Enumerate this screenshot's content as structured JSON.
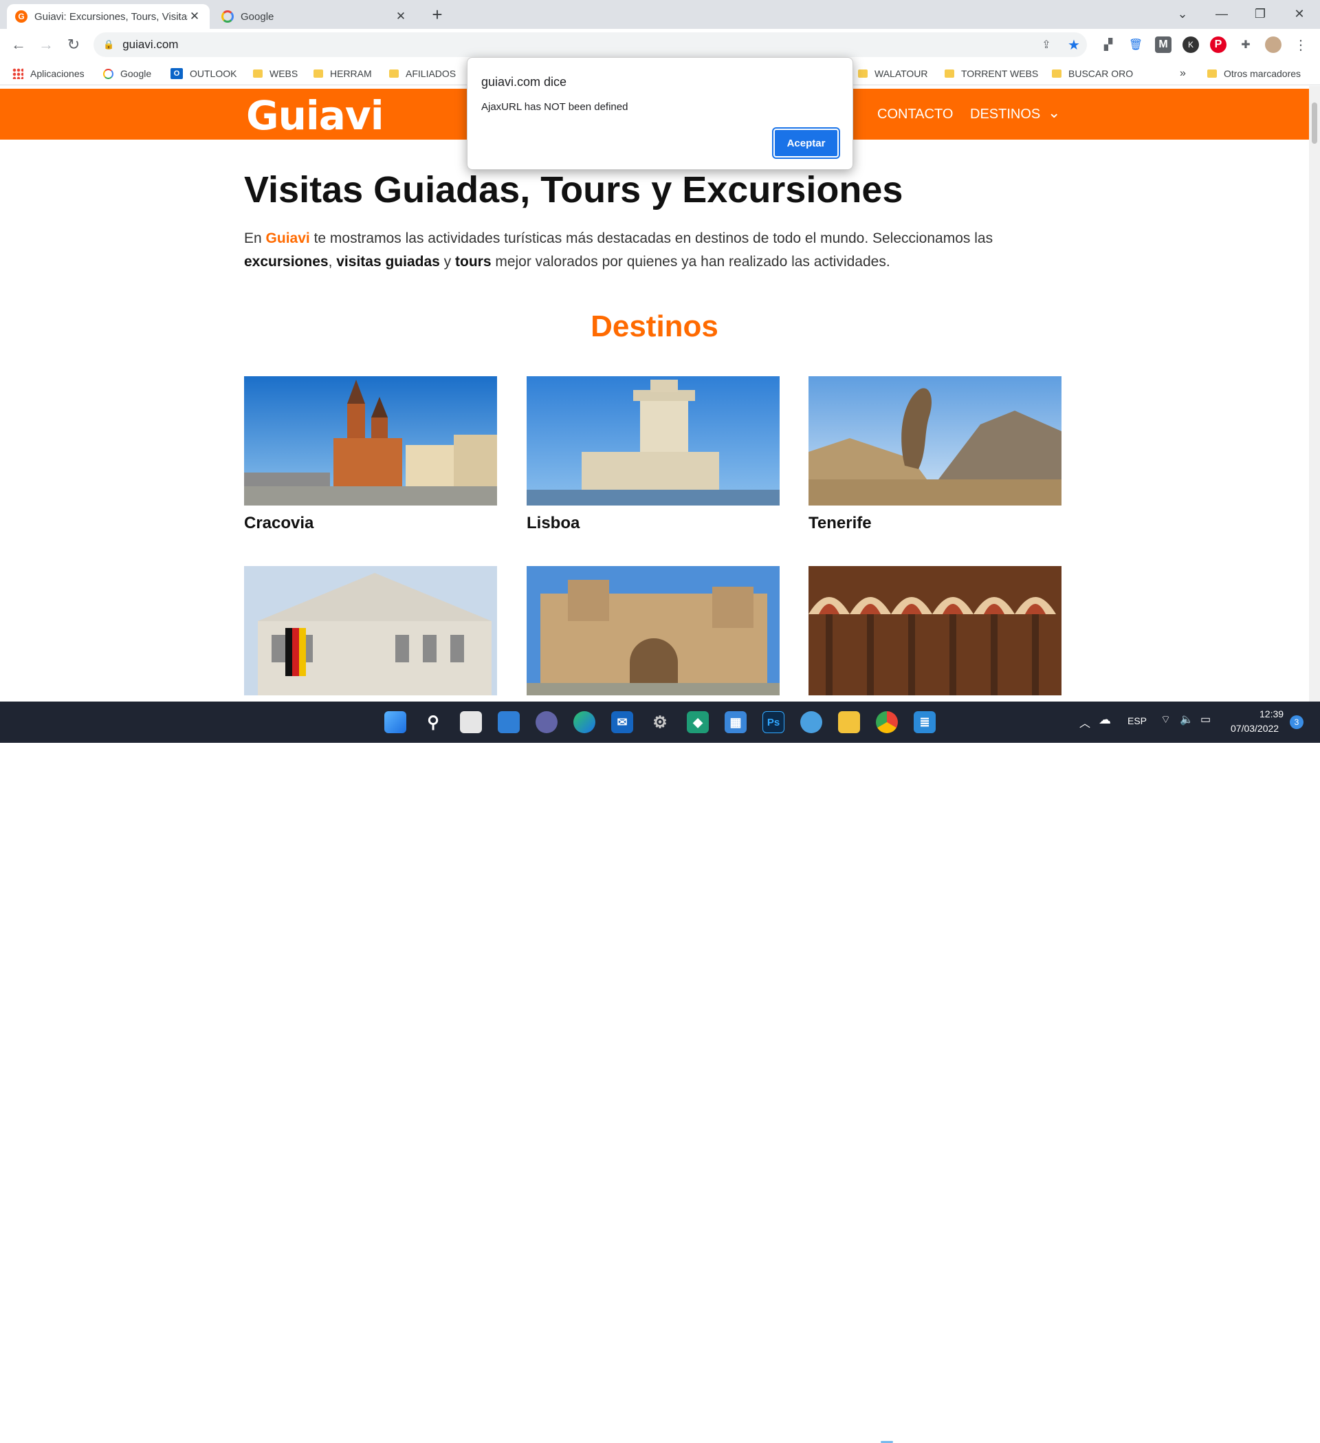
{
  "browser": {
    "tabs": [
      {
        "title": "Guiavi: Excursiones, Tours, Visitas",
        "active": true
      },
      {
        "title": "Google",
        "active": false
      }
    ],
    "new_tab_symbol": "+",
    "url": "guiavi.com",
    "bookmarks": [
      {
        "label": "Aplicaciones",
        "icon": "apps-grid-icon"
      },
      {
        "label": "Google",
        "icon": "google-icon"
      },
      {
        "label": "OUTLOOK",
        "icon": "outlook-icon"
      },
      {
        "label": "WEBS",
        "icon": "folder-icon"
      },
      {
        "label": "HERRAM",
        "icon": "folder-icon"
      },
      {
        "label": "AFILIADOS",
        "icon": "folder-icon"
      },
      {
        "label": "WALATOUR",
        "icon": "folder-icon"
      },
      {
        "label": "TORRENT WEBS",
        "icon": "folder-icon"
      },
      {
        "label": "BUSCAR ORO",
        "icon": "folder-icon"
      }
    ],
    "bookmarks_overflow": "»",
    "other_bookmarks": "Otros marcadores"
  },
  "site": {
    "logo": "Guiavi",
    "menu": [
      {
        "label": "CONTACTO"
      },
      {
        "label": "DESTINOS"
      }
    ],
    "heading": "Visitas Guiadas, Tours y Excursiones",
    "intro": {
      "p1": "En ",
      "brand": "Guiavi",
      "p2": " te mostramos las actividades turísticas más destacadas en destinos de todo el mundo. Seleccionamos las ",
      "b1": "excursiones",
      "p3": ", ",
      "b2": "visitas guiadas",
      "p4": " y ",
      "b3": "tours",
      "p5": " mejor valorados por quienes ya han realizado las actividades."
    },
    "section_title": "Destinos",
    "destinations": [
      {
        "name": "Cracovia"
      },
      {
        "name": "Lisboa"
      },
      {
        "name": "Tenerife"
      },
      {
        "name": ""
      },
      {
        "name": ""
      },
      {
        "name": ""
      }
    ]
  },
  "alert": {
    "title": "guiavi.com dice",
    "message": "AjaxURL has NOT been defined",
    "ok_label": "Aceptar"
  },
  "taskbar": {
    "language": "ESP",
    "time": "12:39",
    "date": "07/03/2022",
    "notifications": "3"
  },
  "colors": {
    "brand": "#ff6a00",
    "dialog_button": "#1a73e8"
  }
}
